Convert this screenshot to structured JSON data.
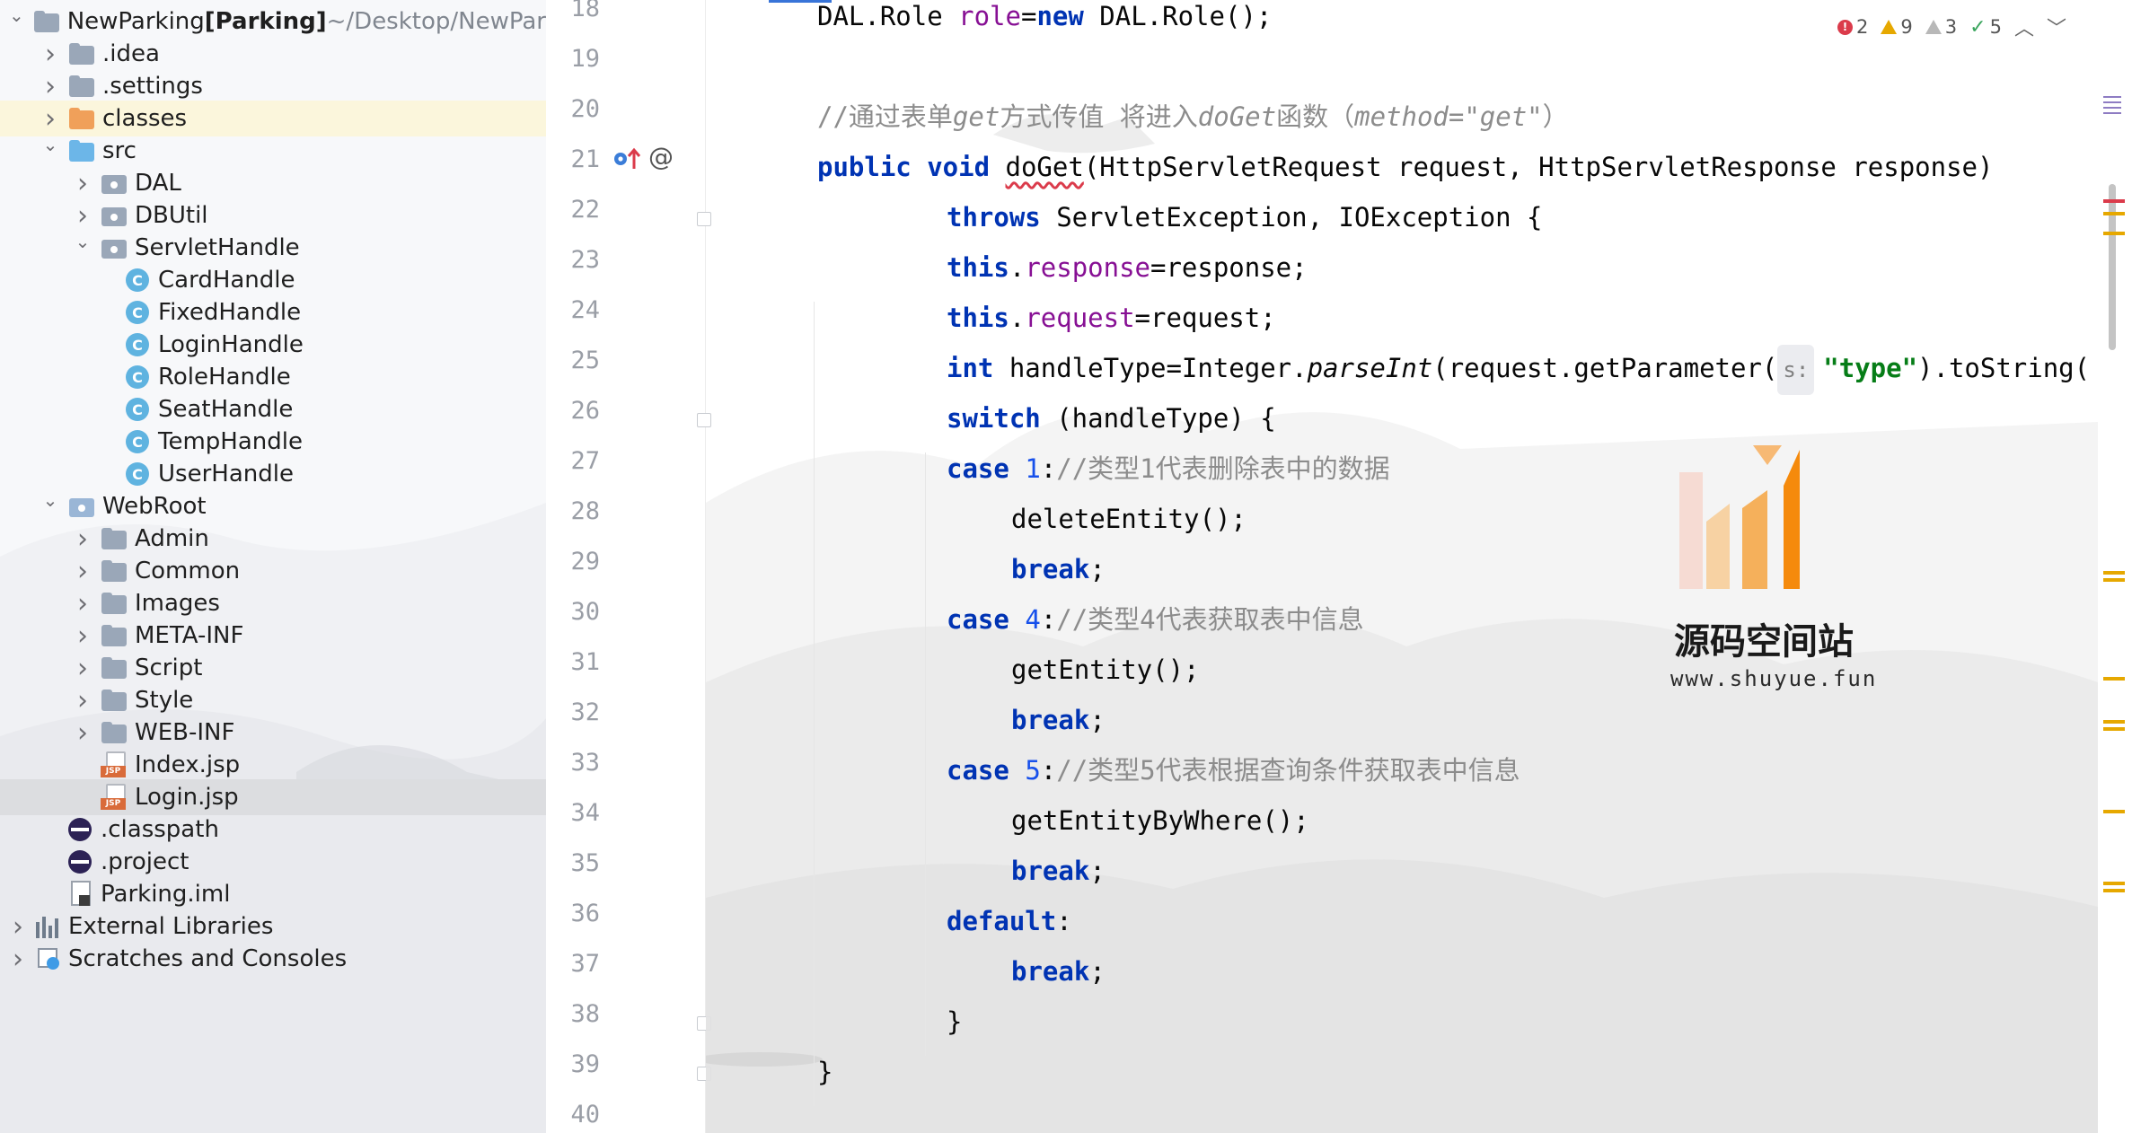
{
  "project_tree": [
    {
      "label": "NewParking",
      "module": "[Parking]",
      "path": "~/Desktop/NewPar",
      "icon": "module-folder-icon",
      "indent": 0,
      "chevron": "down"
    },
    {
      "label": ".idea",
      "icon": "folder-icon",
      "indent": 1,
      "chevron": "right"
    },
    {
      "label": ".settings",
      "icon": "folder-icon",
      "indent": 1,
      "chevron": "right"
    },
    {
      "label": "classes",
      "icon": "excluded-folder-icon",
      "indent": 1,
      "chevron": "right",
      "selected": "yellow"
    },
    {
      "label": "src",
      "icon": "source-folder-icon",
      "indent": 1,
      "chevron": "down"
    },
    {
      "label": "DAL",
      "icon": "package-icon",
      "indent": 2,
      "chevron": "right"
    },
    {
      "label": "DBUtil",
      "icon": "package-icon",
      "indent": 2,
      "chevron": "right"
    },
    {
      "label": "ServletHandle",
      "icon": "package-icon",
      "indent": 2,
      "chevron": "down"
    },
    {
      "label": "CardHandle",
      "icon": "class-icon",
      "indent": 3
    },
    {
      "label": "FixedHandle",
      "icon": "class-icon",
      "indent": 3
    },
    {
      "label": "LoginHandle",
      "icon": "class-icon",
      "indent": 3
    },
    {
      "label": "RoleHandle",
      "icon": "class-icon",
      "indent": 3
    },
    {
      "label": "SeatHandle",
      "icon": "class-icon",
      "indent": 3
    },
    {
      "label": "TempHandle",
      "icon": "class-icon",
      "indent": 3
    },
    {
      "label": "UserHandle",
      "icon": "class-icon",
      "indent": 3
    },
    {
      "label": "WebRoot",
      "icon": "web-folder-icon",
      "indent": 1,
      "chevron": "down"
    },
    {
      "label": "Admin",
      "icon": "folder-icon",
      "indent": 2,
      "chevron": "right"
    },
    {
      "label": "Common",
      "icon": "folder-icon",
      "indent": 2,
      "chevron": "right"
    },
    {
      "label": "Images",
      "icon": "folder-icon",
      "indent": 2,
      "chevron": "right"
    },
    {
      "label": "META-INF",
      "icon": "folder-icon",
      "indent": 2,
      "chevron": "right"
    },
    {
      "label": "Script",
      "icon": "folder-icon",
      "indent": 2,
      "chevron": "right"
    },
    {
      "label": "Style",
      "icon": "folder-icon",
      "indent": 2,
      "chevron": "right"
    },
    {
      "label": "WEB-INF",
      "icon": "folder-icon",
      "indent": 2,
      "chevron": "right"
    },
    {
      "label": "Index.jsp",
      "icon": "jsp-file-icon",
      "indent": 2
    },
    {
      "label": "Login.jsp",
      "icon": "jsp-file-icon",
      "indent": 2,
      "selected": "gray"
    },
    {
      "label": ".classpath",
      "icon": "eclipse-file-icon",
      "indent": 1
    },
    {
      "label": ".project",
      "icon": "eclipse-file-icon",
      "indent": 1
    },
    {
      "label": "Parking.iml",
      "icon": "iml-file-icon",
      "indent": 1
    },
    {
      "label": "External Libraries",
      "icon": "libraries-icon",
      "indent": 0,
      "chevron": "right"
    },
    {
      "label": "Scratches and Consoles",
      "icon": "scratches-icon",
      "indent": 0,
      "chevron": "right"
    }
  ],
  "status": {
    "errors": "2",
    "warnings": "9",
    "weak_warnings": "3",
    "typos": "5"
  },
  "gutter_icons": {
    "line21_override": "override-up-icon",
    "line21_annotation": "@"
  },
  "code_lines": [
    {
      "n": "18",
      "indent": 0,
      "tokens": [
        [
          "DAL.Role ",
          "p"
        ],
        [
          "role",
          "fld"
        ],
        [
          "=",
          "p"
        ],
        [
          "new",
          "kw"
        ],
        [
          " DAL.Role();",
          "p"
        ]
      ]
    },
    {
      "n": "19",
      "indent": 0,
      "tokens": []
    },
    {
      "n": "20",
      "indent": 0,
      "tokens": [
        [
          "//通过表单",
          "cmt"
        ],
        [
          "get",
          "cmt it"
        ],
        [
          "方式传值 将进入",
          "cmt"
        ],
        [
          "doGet",
          "cmt it"
        ],
        [
          "函数（",
          "cmt"
        ],
        [
          "method=\"get\"",
          "cmt it"
        ],
        [
          "）",
          "cmt"
        ]
      ]
    },
    {
      "n": "21",
      "indent": 0,
      "tokens": [
        [
          "public void ",
          "kw"
        ],
        [
          "doGet",
          "p"
        ],
        [
          "(HttpServletRequest request, HttpServletResponse response)",
          "p"
        ]
      ]
    },
    {
      "n": "22",
      "indent": 2,
      "tokens": [
        [
          "throws ",
          "kw"
        ],
        [
          "ServletException, IOException {",
          "p"
        ]
      ]
    },
    {
      "n": "23",
      "indent": 2,
      "tokens": [
        [
          "this",
          "kw"
        ],
        [
          ".",
          "p"
        ],
        [
          "response",
          "fld"
        ],
        [
          "=response;",
          "p"
        ]
      ]
    },
    {
      "n": "24",
      "indent": 2,
      "tokens": [
        [
          "this",
          "kw"
        ],
        [
          ".",
          "p"
        ],
        [
          "request",
          "fld"
        ],
        [
          "=request;",
          "p"
        ]
      ]
    },
    {
      "n": "25",
      "indent": 2,
      "tokens": [
        [
          "int ",
          "kw"
        ],
        [
          "handleType=Integer.",
          "p"
        ],
        [
          "parseInt",
          "p it"
        ],
        [
          "(request.getParameter(",
          "p"
        ],
        [
          "s:",
          "hint"
        ],
        [
          "\"type\"",
          "str"
        ],
        [
          ").toString(",
          "p"
        ]
      ]
    },
    {
      "n": "26",
      "indent": 2,
      "tokens": [
        [
          "switch ",
          "kw"
        ],
        [
          "(handleType) {",
          "p"
        ]
      ]
    },
    {
      "n": "27",
      "indent": 2,
      "tokens": [
        [
          "case ",
          "kw"
        ],
        [
          "1",
          "num"
        ],
        [
          ":",
          "p"
        ],
        [
          "//类型1代表删除表中的数据",
          "cmt"
        ]
      ]
    },
    {
      "n": "28",
      "indent": 3,
      "tokens": [
        [
          "deleteEntity();",
          "p"
        ]
      ]
    },
    {
      "n": "29",
      "indent": 3,
      "tokens": [
        [
          "break",
          "kw"
        ],
        [
          ";",
          "p"
        ]
      ]
    },
    {
      "n": "30",
      "indent": 2,
      "tokens": [
        [
          "case ",
          "kw"
        ],
        [
          "4",
          "num"
        ],
        [
          ":",
          "p"
        ],
        [
          "//类型4代表获取表中信息",
          "cmt"
        ]
      ]
    },
    {
      "n": "31",
      "indent": 3,
      "tokens": [
        [
          "getEntity();",
          "p"
        ]
      ]
    },
    {
      "n": "32",
      "indent": 3,
      "tokens": [
        [
          "break",
          "kw"
        ],
        [
          ";",
          "p"
        ]
      ]
    },
    {
      "n": "33",
      "indent": 2,
      "tokens": [
        [
          "case ",
          "kw"
        ],
        [
          "5",
          "num"
        ],
        [
          ":",
          "p"
        ],
        [
          "//类型5代表根据查询条件获取表中信息",
          "cmt"
        ]
      ]
    },
    {
      "n": "34",
      "indent": 3,
      "tokens": [
        [
          "getEntityByWhere();",
          "p"
        ]
      ]
    },
    {
      "n": "35",
      "indent": 3,
      "tokens": [
        [
          "break",
          "kw"
        ],
        [
          ";",
          "p"
        ]
      ]
    },
    {
      "n": "36",
      "indent": 2,
      "tokens": [
        [
          "default",
          "kw"
        ],
        [
          ":",
          "p"
        ]
      ]
    },
    {
      "n": "37",
      "indent": 3,
      "tokens": [
        [
          "break",
          "kw"
        ],
        [
          ";",
          "p"
        ]
      ]
    },
    {
      "n": "38",
      "indent": 2,
      "tokens": [
        [
          "}",
          "p"
        ]
      ]
    },
    {
      "n": "39",
      "indent": 0,
      "tokens": [
        [
          "}",
          "p"
        ]
      ]
    },
    {
      "n": "40",
      "indent": 0,
      "tokens": []
    }
  ],
  "watermark": {
    "title": "源码空间站",
    "url": "www.shuyue.fun"
  },
  "colors": {
    "keyword": "#0033b3",
    "field": "#871094",
    "string": "#067d17",
    "number": "#1750eb",
    "comment": "#8c8c8c",
    "error": "#db3b4b",
    "warning": "#e6a800"
  }
}
